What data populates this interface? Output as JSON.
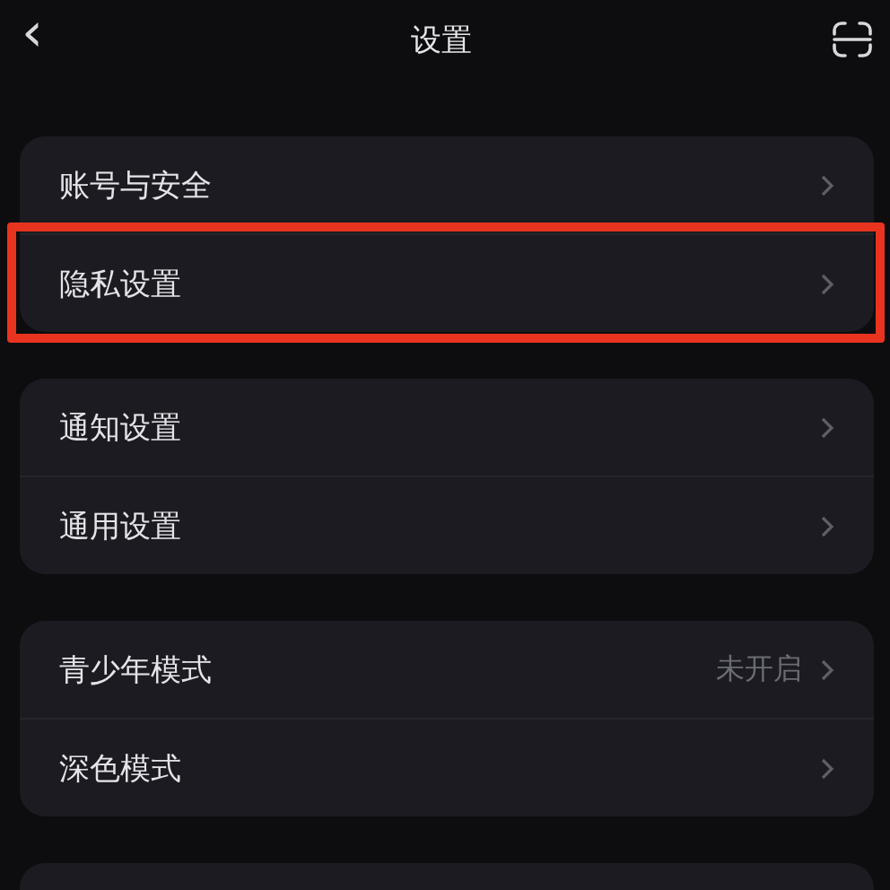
{
  "header": {
    "back": "‹",
    "title": "设置"
  },
  "groups": [
    {
      "items": [
        {
          "label": "账号与安全",
          "highlighted": false
        },
        {
          "label": "隐私设置",
          "highlighted": true
        }
      ]
    },
    {
      "items": [
        {
          "label": "通知设置",
          "highlighted": false
        },
        {
          "label": "通用设置",
          "highlighted": false
        }
      ]
    },
    {
      "items": [
        {
          "label": "青少年模式",
          "value": "未开启",
          "highlighted": false
        },
        {
          "label": "深色模式",
          "highlighted": false
        }
      ]
    },
    {
      "kind": "partial"
    }
  ]
}
